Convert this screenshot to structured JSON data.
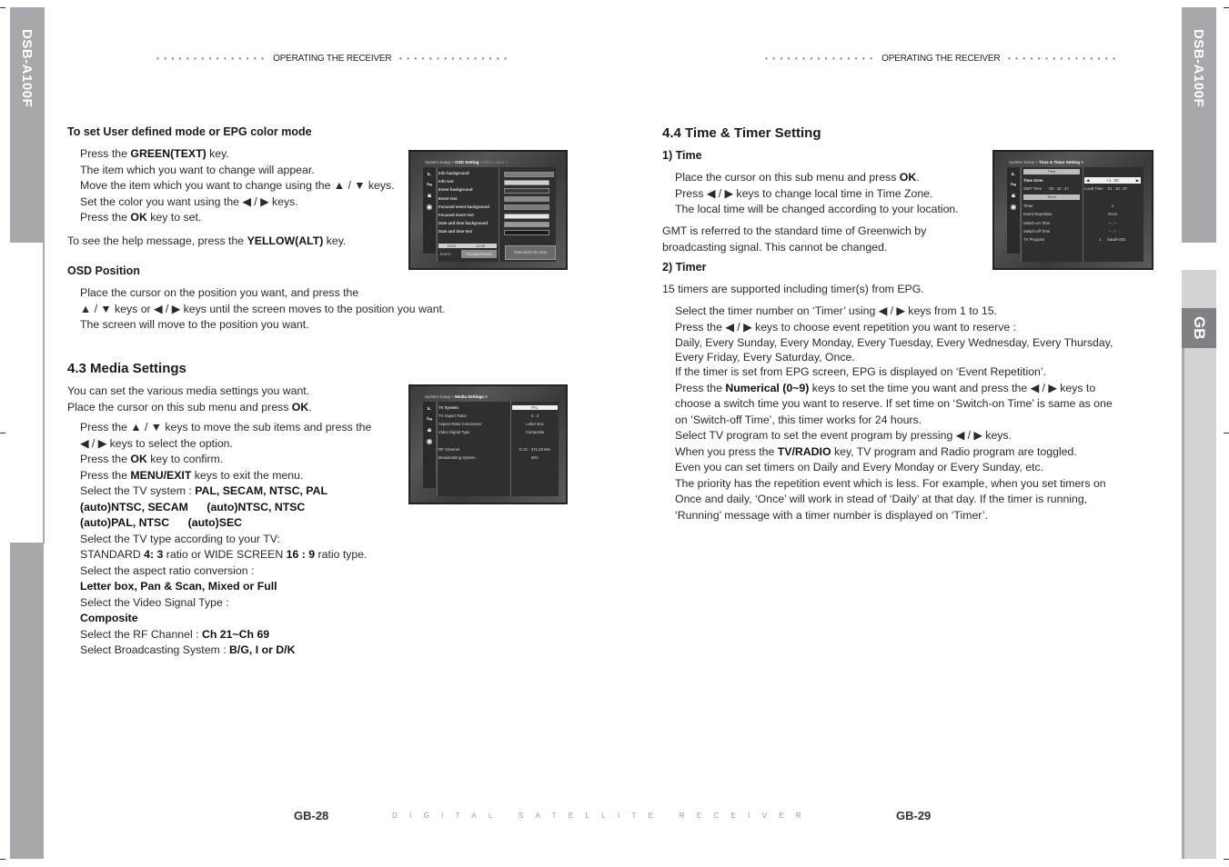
{
  "side_tabs": {
    "left_model": "DSB-A100F",
    "right_model": "DSB-A100F",
    "right_language": "GB"
  },
  "colors": {
    "tab_gray": "#a7a8ab",
    "tab_light": "#d2d3d5",
    "tab_dark": "#808184"
  },
  "header": {
    "left_running_head": "OPERATING THE RECEIVER",
    "right_running_head": "OPERATING THE RECEIVER",
    "dot_leader": "• • • • • • • • • • • • • • •"
  },
  "left_page": {
    "epg_color": {
      "heading": "To set User defined mode or EPG color mode",
      "steps": [
        {
          "pre": "Press the ",
          "bold": "GREEN(TEXT)",
          "post": " key."
        },
        {
          "pre": "The item which you want to change will appear.",
          "bold": "",
          "post": ""
        },
        {
          "pre": "Move the item which you want to change using the ▲ / ▼ keys.",
          "bold": "",
          "post": ""
        },
        {
          "pre": "Set the color you want using the ◀ / ▶ keys.",
          "bold": "",
          "post": ""
        },
        {
          "pre": "Press the ",
          "bold": "OK",
          "post": " key to set."
        }
      ],
      "help": {
        "pre": "To see the help message, press the ",
        "bold": "YELLOW(ALT)",
        "post": " key."
      }
    },
    "osd_position": {
      "heading": "OSD Position",
      "lines": [
        "Place the cursor on the position you want, and press the",
        "▲ / ▼ keys or ◀ / ▶ keys until the screen moves to the position you want.",
        "The screen will move to the position you want."
      ]
    },
    "media": {
      "heading": "4.3 Media Settings",
      "intro1": "You can set the various media settings you want.",
      "intro2_pre": "Place the cursor on this sub menu and press ",
      "intro2_bold": "OK",
      "intro2_post": ".",
      "l1": "Press the ▲ / ▼ keys to move the sub items and press the",
      "l2": "◀ / ▶ keys to select the option.",
      "l3_pre": "Press the ",
      "l3_bold": "OK",
      "l3_post": " key to confirm.",
      "l4_pre": "Press the ",
      "l4_bold": "MENU/EXIT",
      "l4_post": " keys to exit the menu.",
      "l5_pre": "Select the TV system : ",
      "l5_bold": "PAL, SECAM, NTSC, PAL",
      "l6_bold": "(auto)NTSC, SECAM      (auto)NTSC, NTSC",
      "l7_bold": "(auto)PAL, NTSC      (auto)SEC",
      "l8": "Select the TV type according to your TV:",
      "l9_a": "STANDARD ",
      "l9_b": "4: 3",
      "l9_c": " ratio or WIDE SCREEN ",
      "l9_d": "16 : 9",
      "l9_e": " ratio type.",
      "l10": "Select the aspect ratio conversion :",
      "l11_bold": "Letter box, Pan & Scan, Mixed or Full",
      "l12": "Select the Video Signal Type :",
      "l13_bold": "Composite",
      "l14_pre": "Select the RF Channel : ",
      "l14_bold": "Ch 21~Ch 69",
      "l15_pre": "Select Broadcasting System : ",
      "l15_bold": "B/G, I or D/K"
    },
    "page_number": "GB-28"
  },
  "right_page": {
    "time_timer": {
      "heading": "4.4 Time & Timer Setting",
      "sub1": "1) Time",
      "t1_pre": "Place the cursor on this sub menu and press ",
      "t1_bold": "OK",
      "t1_post": ".",
      "t2": "Press ◀ / ▶ keys to change local time in Time Zone.",
      "t3": "The local time will be changed according to your location.",
      "gmt1": "GMT is referred to the standard time of Greenwich by",
      "gmt2": "broadcasting signal. This cannot be changed.",
      "sub2": "2) Timer",
      "count": "15 timers are supported including timer(s) from EPG.",
      "r1": "Select the timer number on ‘Timer’ using ◀ / ▶ keys from 1 to 15.",
      "r2": "Press the ◀ / ▶ keys to choose event repetition you want to reserve :",
      "r3": "Daily, Every Sunday, Every Monday, Every Tuesday, Every Wednesday, Every Thursday,",
      "r4": "Every Friday, Every Saturday, Once.",
      "r5": "If the timer is set from EPG screen, EPG is displayed on ‘Event Repetition’.",
      "r6_pre": "Press the ",
      "r6_bold": "Numerical (0~9)",
      "r6_post": " keys to set the time you want and press the ◀ / ▶ keys to",
      "r7": "choose a switch time you want to reserve. If set time on ‘Switch-on Time’ is same as one",
      "r8": "on ’Switch-off Time’, this timer works for 24 hours.",
      "r9": "Select TV program to set the event program by pressing ◀ / ▶ keys.",
      "r10_pre": "When you press the ",
      "r10_bold": "TV/RADIO",
      "r10_post": " key, TV program and Radio program are toggled.",
      "r11": "Even you can set timers on Daily and Every Monday or Every Sunday, etc.",
      "r12": "The priority has the repetition event which is less. For example, when you set timers on",
      "r13": "Once and daily, ‘Once’ will work in stead of ‘Daily’ at that day. If the timer is running,",
      "r14": "‘Running’ message with a timer number is displayed on ‘Timer’."
    },
    "page_number": "GB-29"
  },
  "footer": {
    "tagline": "DIGITAL SATELLITE RECEIVER"
  },
  "screens": {
    "epg_colors": {
      "crumb_a": "System Setup > ",
      "crumb_b": "OSD Setting",
      "crumb_c": " > EPG colors >",
      "items": [
        "Info background",
        "Info text",
        "Event background",
        "Event text",
        "Focused event background",
        "Focused event text",
        "Date and time background",
        "Date and time text"
      ],
      "swatches": [
        "#7a7a7a",
        "#d0d0d0",
        "#3a3a3a",
        "#8a8a8a",
        "#7c7c7c",
        "#e6e6e6",
        "#9a9a9a",
        "#1a1a1a"
      ],
      "time_a": "13:00",
      "time_b": "13:30",
      "event": "Event",
      "focused_event": "Focused event",
      "extended": "Extended info area"
    },
    "media": {
      "crumb_a": "System Setup > ",
      "crumb_b": "Media Settings >",
      "rows": [
        {
          "label": "TV System",
          "value": "PAL"
        },
        {
          "label": "TV Aspect Ratio",
          "value": "4 : 3"
        },
        {
          "label": "Aspect Ratio Conversion",
          "value": "Letter Box"
        },
        {
          "label": "Video Signal Type",
          "value": "Composite"
        },
        {
          "label": "RF Channel",
          "value": "E 21 - 471.25 MH"
        },
        {
          "label": "Broadcasting System",
          "value": "B/G"
        }
      ]
    },
    "timer": {
      "crumb_a": "System Setup > ",
      "crumb_b": "Time & Timer Setting >",
      "time_header": "Time",
      "time_zone_label": "Time Zone",
      "time_zone_value": "+1 : 00",
      "gmt_label": "GMT Time",
      "gmt_value": "00 : 15 : 47",
      "local_label": "Local Time",
      "local_value": "01 : 15 : 47",
      "timer_header": "Timer",
      "rows": [
        {
          "label": "Timer",
          "value": "1"
        },
        {
          "label": "Event Repetition",
          "value": "Once"
        },
        {
          "label": "Switch-on Time",
          "value": "-- : --"
        },
        {
          "label": "Switch-off Time",
          "value": "-- : --"
        },
        {
          "label": "TV Program",
          "value": "1     Saudi-O01"
        }
      ]
    }
  }
}
